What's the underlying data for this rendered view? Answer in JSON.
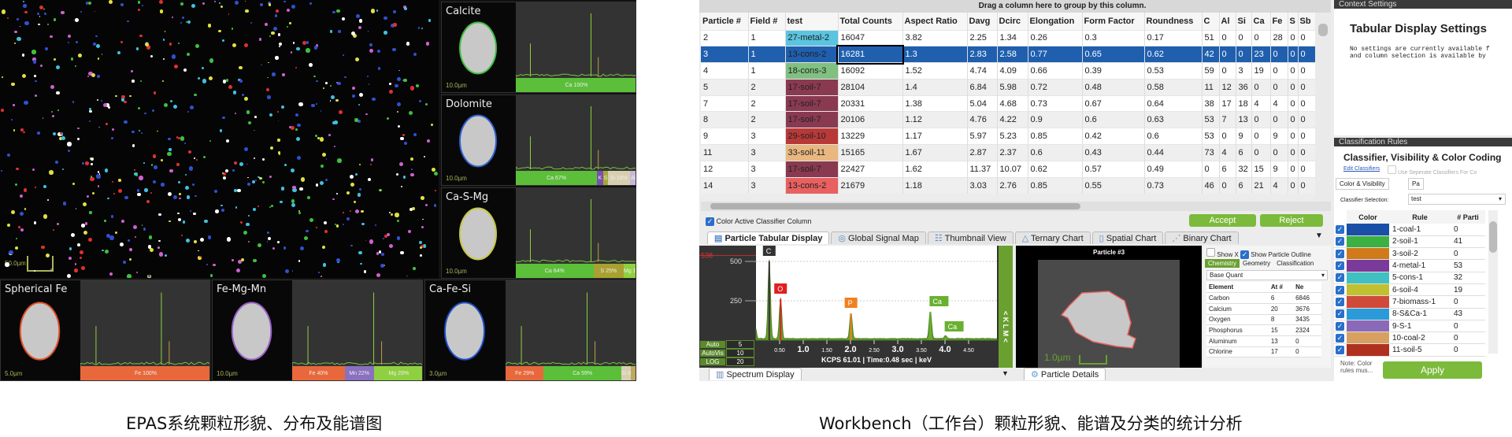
{
  "left_panel": {
    "map_scale": "50.0µm",
    "cells": [
      {
        "title": "Calcite",
        "scale": "10.0µm",
        "outline": "#3fbf3f",
        "bars": [
          {
            "label": "Ca 100%",
            "pct": 100,
            "color": "#5cbf3a"
          }
        ]
      },
      {
        "title": "Dolomite",
        "scale": "10.0µm",
        "outline": "#3060d0",
        "bars": [
          {
            "label": "Ca 67%",
            "pct": 67,
            "color": "#5cbf3a"
          },
          {
            "label": "K",
            "pct": 5,
            "color": "#7a4fb0"
          },
          {
            "label": "S",
            "pct": 4,
            "color": "#a8a838"
          },
          {
            "label": "Si 18%",
            "pct": 18,
            "color": "#d8cfb0"
          },
          {
            "label": "Al",
            "pct": 6,
            "color": "#c8b8d8"
          }
        ]
      },
      {
        "title": "Ca-S-Mg",
        "scale": "10.0µm",
        "outline": "#c8c840",
        "bars": [
          {
            "label": "Ca 64%",
            "pct": 64,
            "color": "#5cbf3a"
          },
          {
            "label": "S 25%",
            "pct": 25,
            "color": "#a8a030"
          },
          {
            "label": "Mg 11%",
            "pct": 11,
            "color": "#8fd040"
          }
        ]
      },
      {
        "title": "Spherical Fe",
        "scale": "5.0µm",
        "outline": "#e0502a",
        "bars": [
          {
            "label": "Fe 100%",
            "pct": 100,
            "color": "#e8683c"
          }
        ]
      },
      {
        "title": "Fe-Mg-Mn",
        "scale": "10.0µm",
        "outline": "#9a60c8",
        "bars": [
          {
            "label": "Fe 40%",
            "pct": 40,
            "color": "#e8683c"
          },
          {
            "label": "Mn 22%",
            "pct": 22,
            "color": "#8a70c0"
          },
          {
            "label": "Mg 29%",
            "pct": 38,
            "color": "#8fd040"
          }
        ]
      },
      {
        "title": "Ca-Fe-Si",
        "scale": "3.0µm",
        "outline": "#2050c8",
        "bars": [
          {
            "label": "Fe 29%",
            "pct": 29,
            "color": "#e8683c"
          },
          {
            "label": "Ca 59%",
            "pct": 59,
            "color": "#5cbf3a"
          },
          {
            "label": "Si 9%",
            "pct": 7,
            "color": "#d8cfb0"
          },
          {
            "label": "",
            "pct": 5,
            "color": "#bfa860"
          }
        ]
      }
    ],
    "caption": "EPAS系统颗粒形貌、分布及能谱图"
  },
  "workbench": {
    "drag_hint": "Drag a column here to group by this column.",
    "columns": [
      "Particle #",
      "Field #",
      "test",
      "Total Counts",
      "Aspect Ratio",
      "Davg",
      "Dcirc",
      "Elongation",
      "Form Factor",
      "Roundness",
      "C",
      "Al",
      "Si",
      "Ca",
      "Fe",
      "S",
      "Sb"
    ],
    "rows": [
      {
        "cells": [
          "2",
          "1",
          "27-metal-2",
          "16047",
          "3.82",
          "2.25",
          "1.34",
          "0.26",
          "0.3",
          "0.17",
          "51",
          "0",
          "0",
          "0",
          "28",
          "0",
          "0"
        ],
        "color": "#5bc4e0"
      },
      {
        "cells": [
          "3",
          "1",
          "13-cons-2",
          "16281",
          "1.3",
          "2.83",
          "2.58",
          "0.77",
          "0.65",
          "0.62",
          "42",
          "0",
          "0",
          "23",
          "0",
          "0",
          "0"
        ],
        "color": "#e86060",
        "selected": true
      },
      {
        "cells": [
          "4",
          "1",
          "18-cons-3",
          "16092",
          "1.52",
          "4.74",
          "4.09",
          "0.66",
          "0.39",
          "0.53",
          "59",
          "0",
          "3",
          "19",
          "0",
          "0",
          "0"
        ],
        "color": "#80c080"
      },
      {
        "cells": [
          "5",
          "2",
          "17-soil-7",
          "28104",
          "1.4",
          "6.84",
          "5.98",
          "0.72",
          "0.48",
          "0.58",
          "11",
          "12",
          "36",
          "0",
          "0",
          "0",
          "0"
        ],
        "color": "#8a3a50"
      },
      {
        "cells": [
          "7",
          "2",
          "17-soil-7",
          "20331",
          "1.38",
          "5.04",
          "4.68",
          "0.73",
          "0.67",
          "0.64",
          "38",
          "17",
          "18",
          "4",
          "4",
          "0",
          "0"
        ],
        "color": "#8a3a50"
      },
      {
        "cells": [
          "8",
          "2",
          "17-soil-7",
          "20106",
          "1.12",
          "4.76",
          "4.22",
          "0.9",
          "0.6",
          "0.63",
          "53",
          "7",
          "13",
          "0",
          "0",
          "0",
          "0"
        ],
        "color": "#8a3a50"
      },
      {
        "cells": [
          "9",
          "3",
          "29-soil-10",
          "13229",
          "1.17",
          "5.97",
          "5.23",
          "0.85",
          "0.42",
          "0.6",
          "53",
          "0",
          "9",
          "0",
          "9",
          "0",
          "0"
        ],
        "color": "#b83a38"
      },
      {
        "cells": [
          "11",
          "3",
          "33-soil-11",
          "15165",
          "1.67",
          "2.87",
          "2.37",
          "0.6",
          "0.43",
          "0.44",
          "73",
          "4",
          "6",
          "0",
          "0",
          "0",
          "0"
        ],
        "color": "#e8b880"
      },
      {
        "cells": [
          "12",
          "3",
          "17-soil-7",
          "22427",
          "1.62",
          "11.37",
          "10.07",
          "0.62",
          "0.57",
          "0.49",
          "0",
          "6",
          "32",
          "15",
          "9",
          "0",
          "0"
        ],
        "color": "#8a3a50"
      },
      {
        "cells": [
          "14",
          "3",
          "13-cons-2",
          "21679",
          "1.18",
          "3.03",
          "2.76",
          "0.85",
          "0.55",
          "0.73",
          "46",
          "0",
          "6",
          "21",
          "4",
          "0",
          "0"
        ],
        "color": "#e86060"
      }
    ],
    "color_active_label": "Color Active Classifier Column",
    "accept": "Accept",
    "reject": "Reject",
    "tabs": [
      "Particle Tabular Display",
      "Global Signal Map",
      "Thumbnail View",
      "Ternary Chart",
      "Spatial Chart",
      "Binary Chart"
    ],
    "spectrum": {
      "tab": "Spectrum Display",
      "y_ticks": [
        "500",
        "250"
      ],
      "marker": "538",
      "x_ticks": [
        "0.50",
        "1.0",
        "1.50",
        "2.0",
        "2.50",
        "3.0",
        "3.50",
        "4.0",
        "4.50"
      ],
      "footer": "KCPS 61.01  |  Time:0.48 sec  |  keV",
      "peaks": [
        {
          "label": "C",
          "kev": 0.28,
          "counts": 500,
          "color": "#333333"
        },
        {
          "label": "O",
          "kev": 0.52,
          "counts": 260,
          "color": "#e02020"
        },
        {
          "label": "P",
          "kev": 2.01,
          "counts": 170,
          "color": "#f08020"
        },
        {
          "label": "Ca",
          "kev": 3.69,
          "counts": 180,
          "color": "#6ab030"
        },
        {
          "label": "Ca",
          "kev": 4.01,
          "counts": 20,
          "color": "#6ab030"
        }
      ],
      "controls": [
        {
          "label": "Auto",
          "value": "5"
        },
        {
          "label": "AutoVis",
          "value": "10"
        },
        {
          "label": "LOG",
          "value": "20"
        }
      ],
      "side": "< K L M <"
    },
    "particle": {
      "title": "Particle #3",
      "scale": "1.0µm",
      "show_x": "Show X",
      "show_outline": "Show Particle Outline",
      "subtabs": [
        "Chemistry",
        "Geometry",
        "Classification"
      ],
      "quant": "Base Quant",
      "chem_headers": [
        "Element",
        "At #",
        "Ne"
      ],
      "chem_rows": [
        [
          "Carbon",
          "6",
          "6846"
        ],
        [
          "Calcium",
          "20",
          "3676"
        ],
        [
          "Oxygen",
          "8",
          "3435"
        ],
        [
          "Phosphorus",
          "15",
          "2324"
        ],
        [
          "Aluminum",
          "13",
          "0"
        ],
        [
          "Chlorine",
          "17",
          "0"
        ]
      ],
      "tab": "Particle Details"
    },
    "context": {
      "header": "Context Settings",
      "title": "Tabular Display Settings",
      "text1": "No settings are currently available f",
      "text2": "and column selection is available by"
    },
    "classification": {
      "header": "Classification Rules",
      "title": "Classifier, Visibility & Color Coding",
      "edit": "Edit Classifiers",
      "separate": "Use Seperate Classifiers For Co",
      "tab1": "Color & Visibility",
      "tab2": "Pa",
      "selection_label": "Classifier Selection:",
      "selection_value": "test",
      "headers": [
        "Color",
        "Rule",
        "# Parti"
      ],
      "rules": [
        {
          "color": "#1a4fa8",
          "rule": "1-coal-1",
          "count": "0"
        },
        {
          "color": "#3cb043",
          "rule": "2-soil-1",
          "count": "41"
        },
        {
          "color": "#d07a1a",
          "rule": "3-soil-2",
          "count": "0"
        },
        {
          "color": "#7a3a9a",
          "rule": "4-metal-1",
          "count": "53"
        },
        {
          "color": "#40c0c0",
          "rule": "5-cons-1",
          "count": "32"
        },
        {
          "color": "#c0c030",
          "rule": "6-soil-4",
          "count": "19"
        },
        {
          "color": "#d04a3a",
          "rule": "7-biomass-1",
          "count": "0"
        },
        {
          "color": "#2a9ad8",
          "rule": "8-S&Ca-1",
          "count": "43"
        },
        {
          "color": "#8a6ab8",
          "rule": "9-S-1",
          "count": "0"
        },
        {
          "color": "#d8a060",
          "rule": "10-coal-2",
          "count": "0"
        },
        {
          "color": "#b03020",
          "rule": "11-soil-5",
          "count": "0"
        }
      ],
      "note": "Note: Color rules mus...",
      "apply": "Apply"
    },
    "caption": "Workbench（工作台）颗粒形貌、能谱及分类的统计分析"
  }
}
